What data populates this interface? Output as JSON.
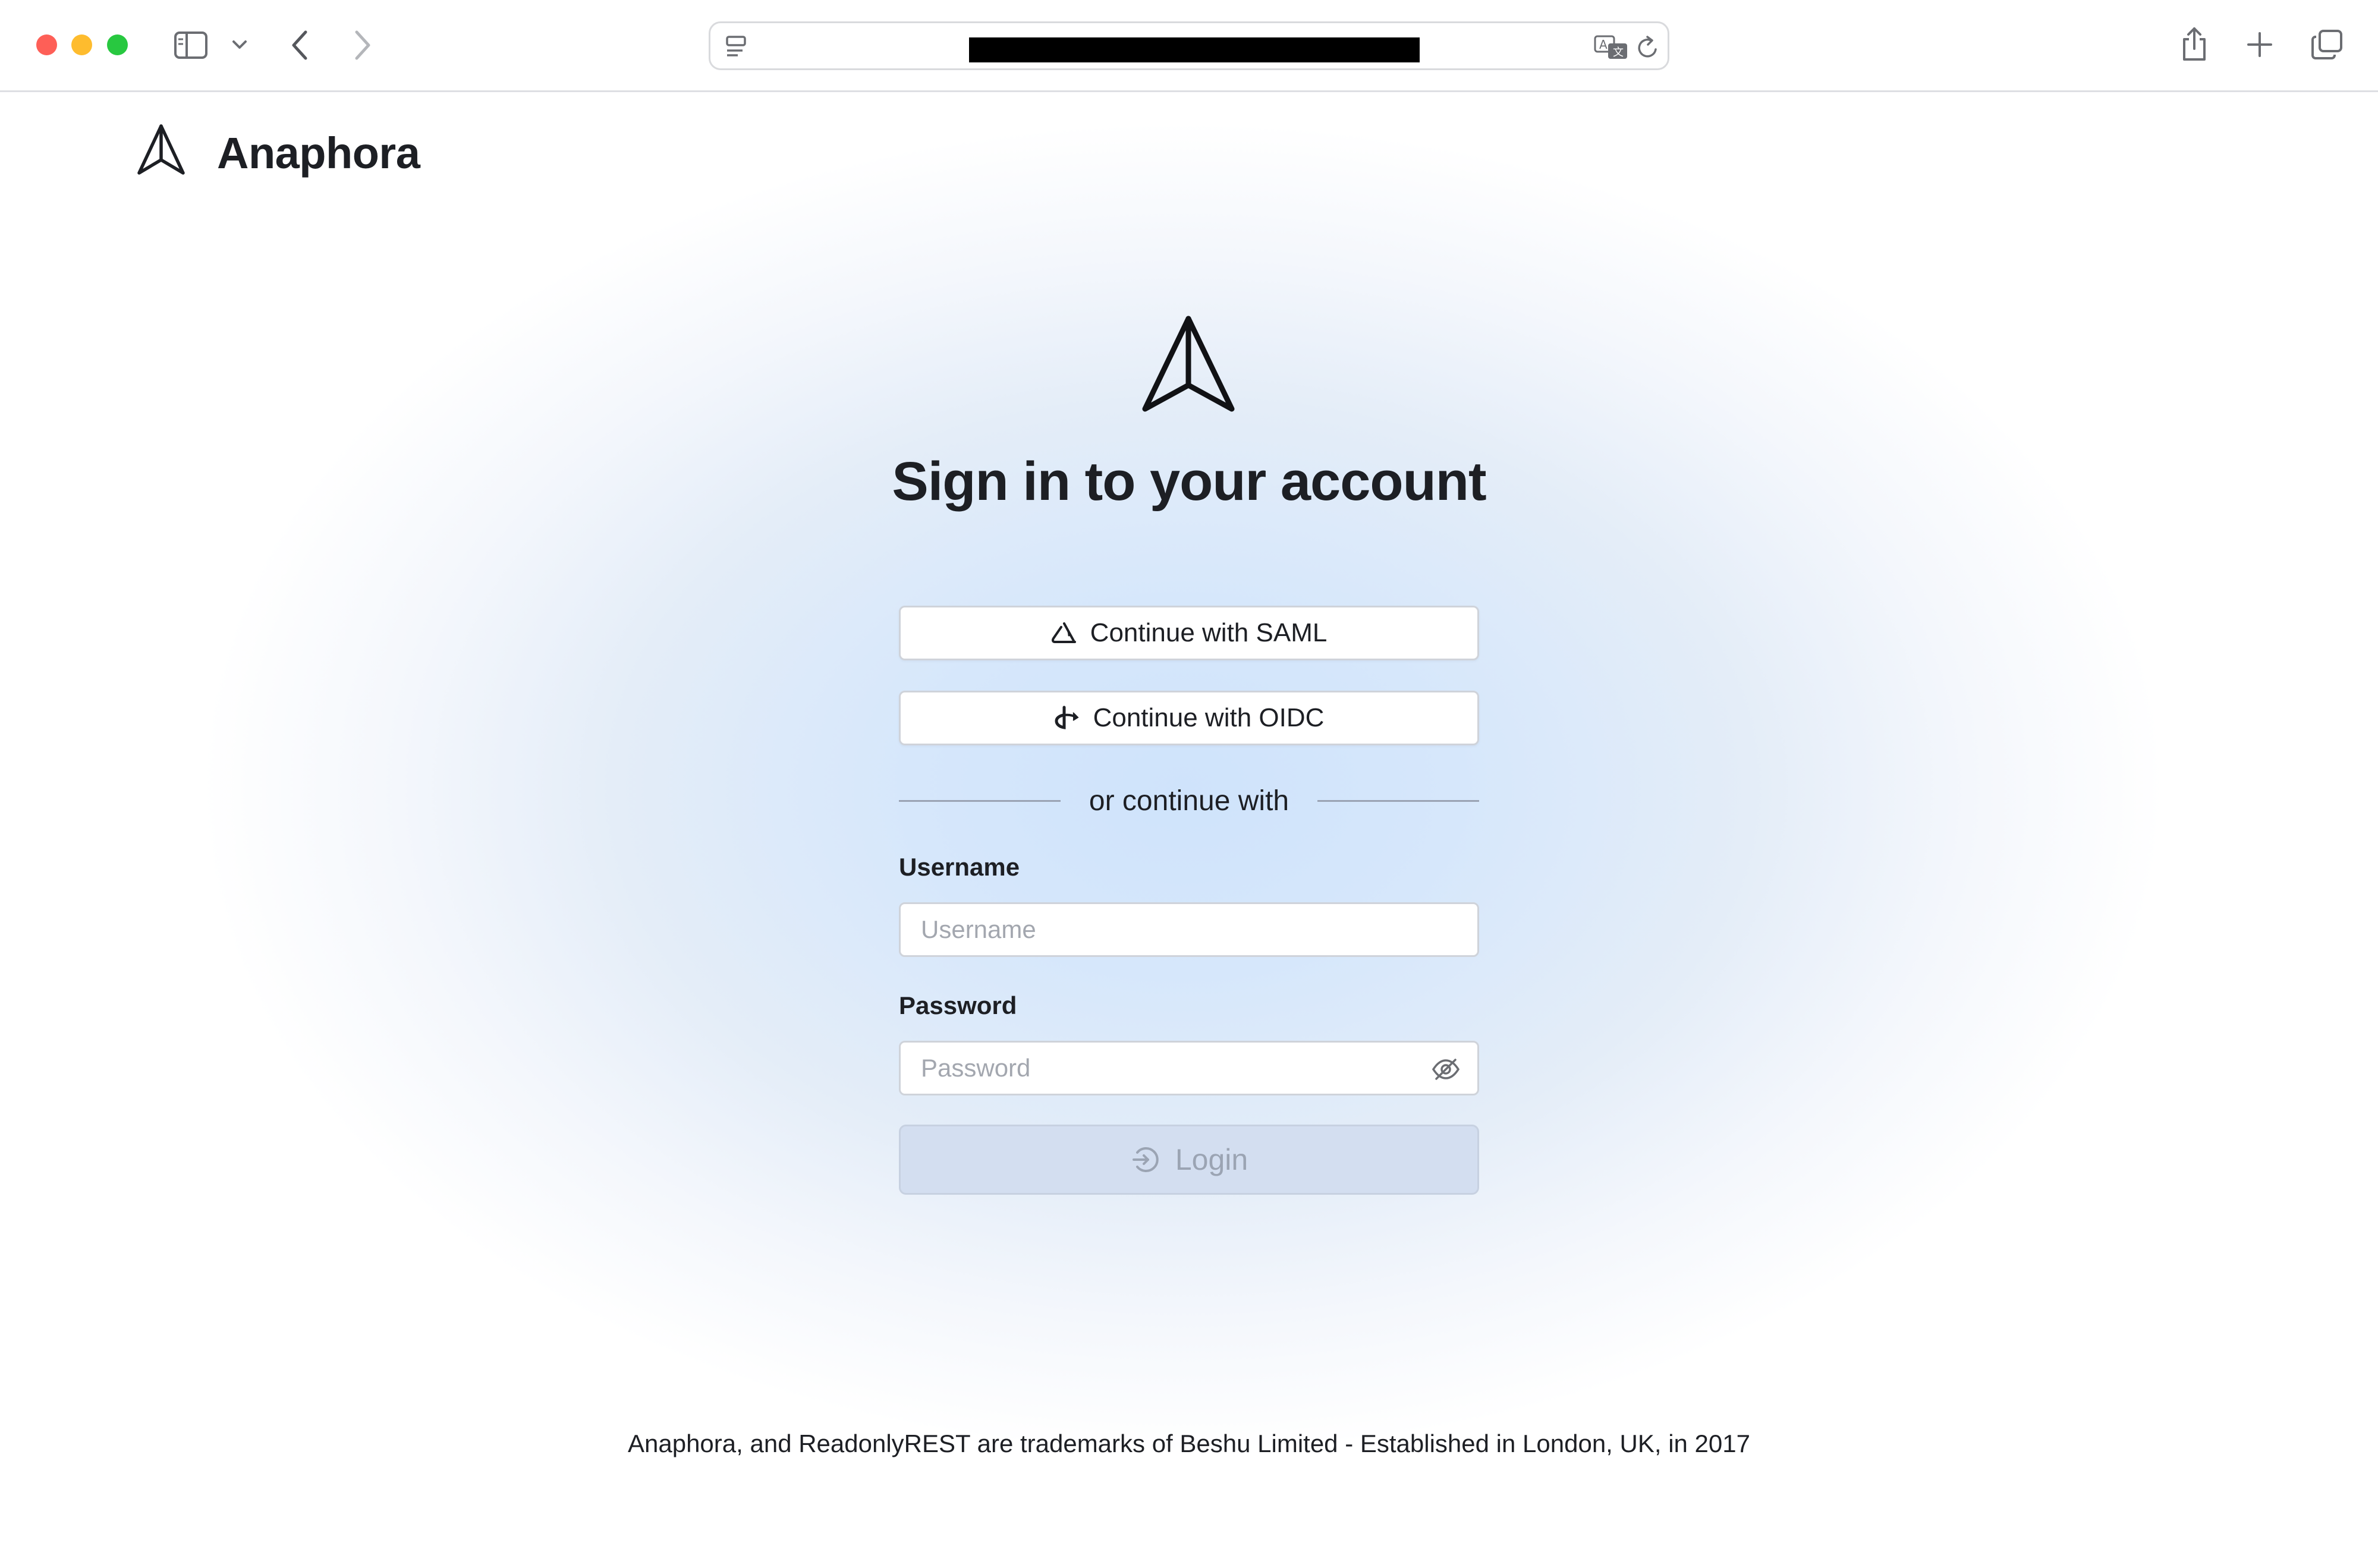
{
  "browser": {
    "address_redacted": true,
    "icons": [
      "sidebar-icon",
      "chevron-down-icon",
      "back-icon",
      "forward-icon",
      "page-menu-icon",
      "translate-icon",
      "reload-icon",
      "share-icon",
      "new-tab-icon",
      "tab-overview-icon"
    ]
  },
  "header": {
    "brand_name": "Anaphora"
  },
  "login": {
    "title": "Sign in to your account",
    "saml_button": "Continue with SAML",
    "oidc_button": "Continue with OIDC",
    "divider_text": "or continue with",
    "username_label": "Username",
    "username_placeholder": "Username",
    "username_value": "",
    "password_label": "Password",
    "password_placeholder": "Password",
    "password_value": "",
    "login_button": "Login"
  },
  "footer": {
    "text": "Anaphora, and ReadonlyREST are trademarks of Beshu Limited - Established in London, UK, in 2017"
  },
  "colors": {
    "accent_glow": "#cfe3fb",
    "text": "#1d1f24",
    "login_disabled_bg": "#d3def0"
  }
}
